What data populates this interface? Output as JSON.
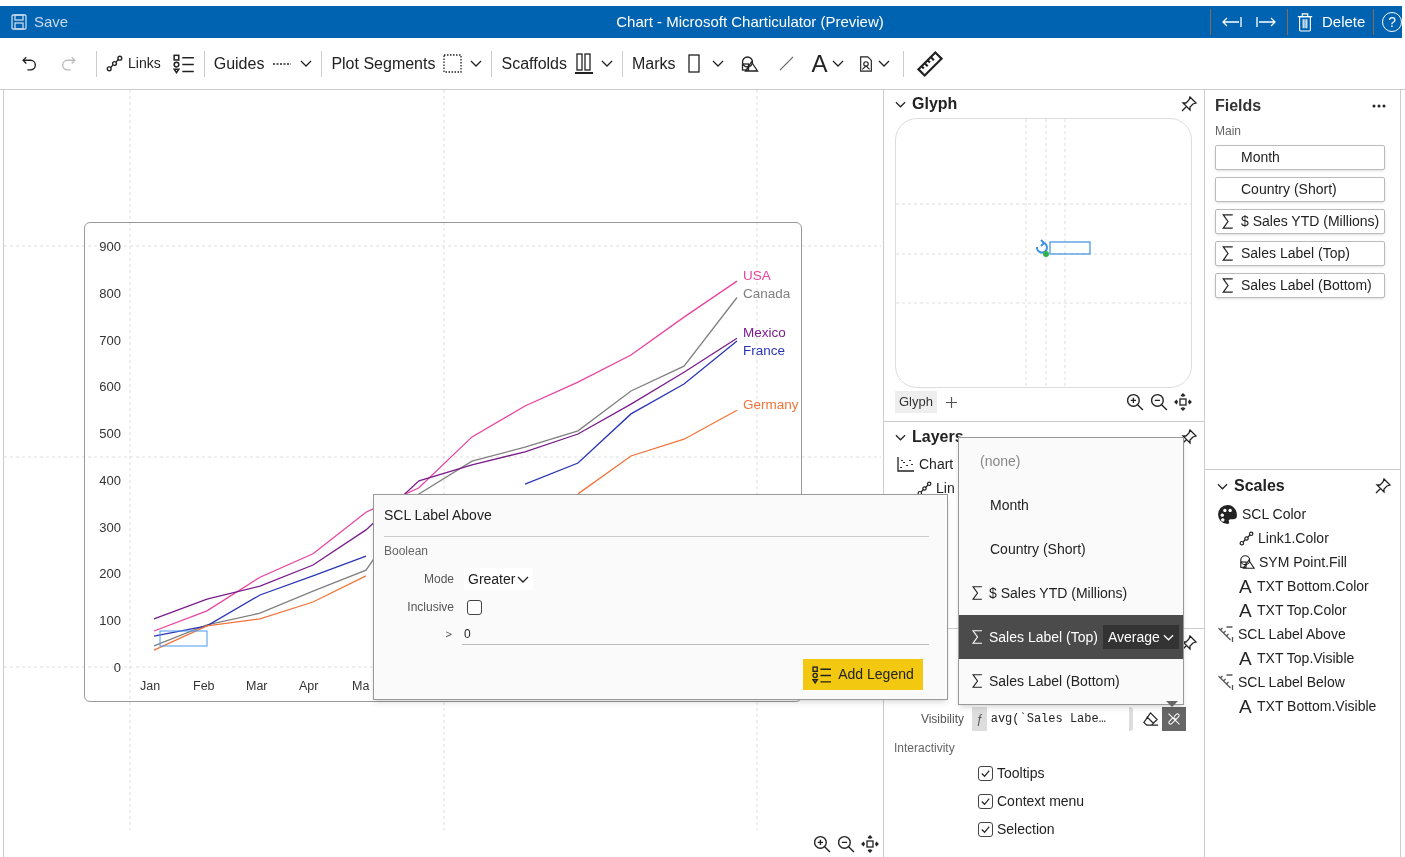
{
  "title_bar": {
    "save": "Save",
    "title": "Chart - Microsoft Charticulator (Preview)",
    "delete": "Delete",
    "help": "?"
  },
  "toolbar": {
    "links": "Links",
    "guides": "Guides",
    "plot_segments": "Plot Segments",
    "scaffolds": "Scaffolds",
    "marks": "Marks",
    "text_tool": "A"
  },
  "canvas": {
    "chart": {
      "chart_data": {
        "type": "line",
        "categories": [
          "Jan",
          "Feb",
          "Mar",
          "Apr",
          "Ma",
          null,
          null,
          null,
          null,
          null,
          null,
          null
        ],
        "ylim": [
          0,
          900
        ],
        "yticks": [
          0,
          100,
          200,
          300,
          400,
          500,
          600,
          700,
          800,
          900
        ],
        "series": [
          {
            "name": "USA",
            "color": "#e8449f",
            "values": [
              77,
              120,
              192,
              242,
              331,
              383,
              492,
              558,
              609,
              667,
              748,
              825
            ]
          },
          {
            "name": "Canada",
            "color": "#808080",
            "values": [
              45,
              90,
              115,
              162,
              207,
              370,
              440,
              470,
              505,
              590,
              643,
              790
            ]
          },
          {
            "name": "Mexico",
            "color": "#7a1c8c",
            "values": [
              103,
              145,
              173,
              218,
              293,
              398,
              432,
              460,
              498,
              562,
              630,
              703
            ]
          },
          {
            "name": "France",
            "color": "#2b36b5",
            "values": [
              66,
              88,
              154,
              195,
              237,
              null,
              null,
              391,
              436,
              541,
              605,
              697
            ]
          },
          {
            "name": "Germany",
            "color": "#f0743c",
            "values": [
              36,
              88,
              103,
              139,
              195,
              null,
              null,
              null,
              370,
              451,
              487,
              549
            ]
          }
        ]
      }
    }
  },
  "glyph_panel": {
    "title": "Glyph",
    "tab": "Glyph"
  },
  "layers_panel": {
    "title": "Layers",
    "items": [
      {
        "label": "Chart",
        "kind": "chart",
        "children": [
          {
            "label": "Lin",
            "kind": "link"
          }
        ]
      }
    ]
  },
  "attributes_panel": {
    "visibility_label": "Visibility",
    "function_mark": "ƒ",
    "visibility_expression": "avg(`Sales Labe…",
    "interactivity_label": "Interactivity",
    "checkboxes": [
      {
        "label": "Tooltips",
        "checked": true
      },
      {
        "label": "Context menu",
        "checked": true
      },
      {
        "label": "Selection",
        "checked": true
      }
    ]
  },
  "fields_panel": {
    "title": "Fields",
    "group": "Main",
    "fields": [
      {
        "label": "Month",
        "kind": "plain"
      },
      {
        "label": "Country (Short)",
        "kind": "plain"
      },
      {
        "label": "$ Sales YTD (Millions)",
        "kind": "measure"
      },
      {
        "label": "Sales Label (Top)",
        "kind": "measure"
      },
      {
        "label": "Sales Label (Bottom)",
        "kind": "measure"
      }
    ]
  },
  "scales_panel": {
    "title": "Scales",
    "items": [
      {
        "label": "SCL Color",
        "kind": "palette",
        "children": [
          {
            "label": "Link1.Color",
            "kind": "link"
          },
          {
            "label": "SYM Point.Fill",
            "kind": "symbol"
          },
          {
            "label": "TXT Bottom.Color",
            "kind": "text",
            "icon": "A"
          },
          {
            "label": "TXT Top.Color",
            "kind": "text",
            "icon": "A"
          }
        ]
      },
      {
        "label": "SCL Label Above",
        "kind": "scale",
        "children": [
          {
            "label": "TXT Top.Visible",
            "kind": "text",
            "icon": "A"
          }
        ]
      },
      {
        "label": "SCL Label Below",
        "kind": "scale",
        "children": [
          {
            "label": "TXT Bottom.Visible",
            "kind": "text",
            "icon": "A"
          }
        ]
      }
    ]
  },
  "scale_popup": {
    "title": "SCL Label Above",
    "section": "Boolean",
    "mode_label": "Mode",
    "mode": "Greater",
    "inclusive_label": "Inclusive",
    "inclusive": false,
    "threshold_operator": ">",
    "threshold": "0",
    "button": "Add Legend"
  },
  "field_menu": {
    "items": [
      {
        "label": "(none)",
        "kind": "empty",
        "selected": false
      },
      {
        "label": "Month",
        "kind": "plain",
        "selected": false
      },
      {
        "label": "Country (Short)",
        "kind": "plain",
        "selected": false
      },
      {
        "label": "$ Sales YTD (Millions)",
        "kind": "measure",
        "selected": false
      },
      {
        "label": "Sales Label (Top)",
        "kind": "measure",
        "selected": true,
        "aggregation": "Average"
      },
      {
        "label": "Sales Label (Bottom)",
        "kind": "measure",
        "selected": false
      }
    ]
  }
}
